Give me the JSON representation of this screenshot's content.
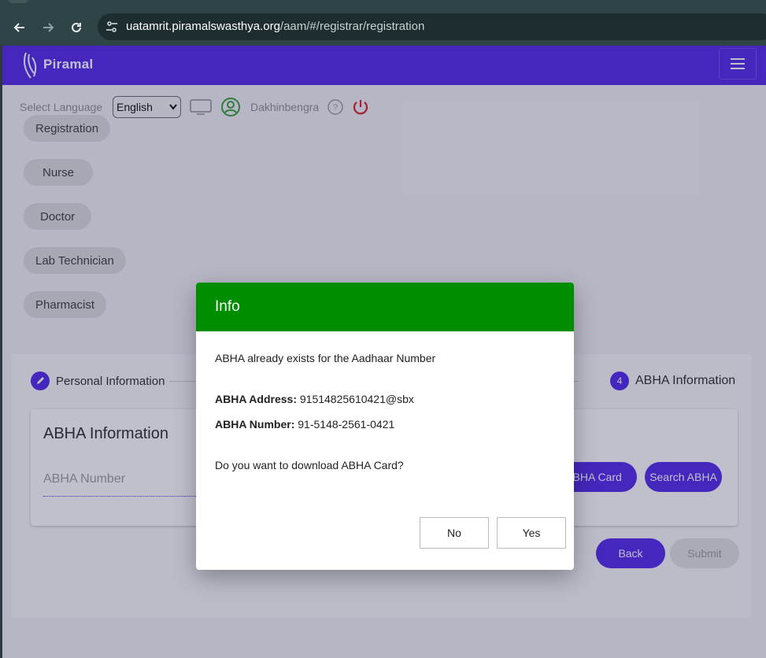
{
  "browser": {
    "url_host": "uatamrit.piramalswasthya.org",
    "url_path": "/aam/#/registrar/registration"
  },
  "app": {
    "brand": "Piramal"
  },
  "topbar": {
    "lang_label": "Select Language",
    "lang_value": "English",
    "username": "Dakhinbengra"
  },
  "roles": [
    "Registration",
    "Nurse",
    "Doctor",
    "Lab Technician",
    "Pharmacist"
  ],
  "stepper": {
    "step1_label": "Personal Information",
    "step4_number": "4",
    "step4_label": "ABHA Information"
  },
  "abha_card": {
    "title": "ABHA Information",
    "input_placeholder": "ABHA Number",
    "download_label": "ABHA Card",
    "search_label": "Search ABHA"
  },
  "footer_buttons": {
    "back": "Back",
    "submit": "Submit"
  },
  "dialog": {
    "title": "Info",
    "message": "ABHA already exists for the Aadhaar Number",
    "address_label": "ABHA Address:",
    "address_value": "91514825610421@sbx",
    "number_label": "ABHA Number:",
    "number_value": "91-5148-2561-0421",
    "question": "Do you want to download ABHA Card?",
    "no": "No",
    "yes": "Yes"
  },
  "colors": {
    "brand": "#4b1ee8",
    "dialog_header": "#008e00"
  }
}
